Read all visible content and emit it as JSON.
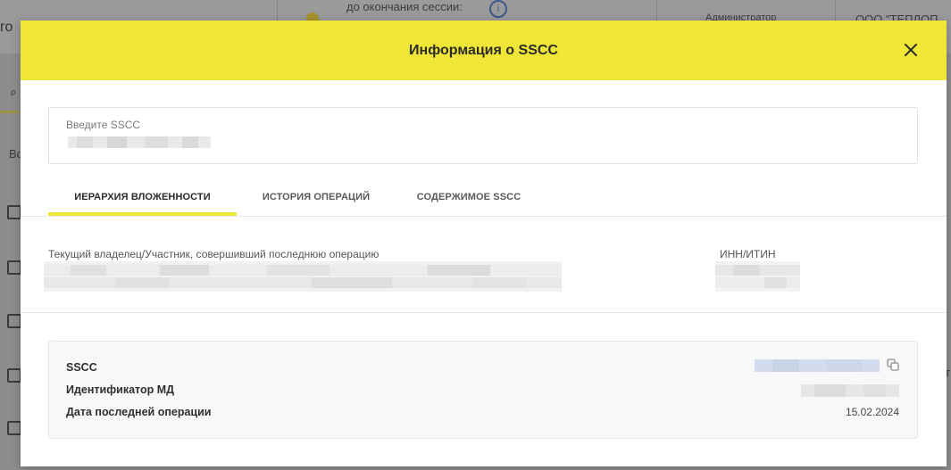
{
  "background": {
    "logo_fragment": "го",
    "session_text": "до окончания сессии:",
    "admin_text": "Администратор",
    "org_text": "ООО \"ТЕПЛОП",
    "tab_fragment": "Р",
    "left_fragment": "Во",
    "right_fragment": "т"
  },
  "modal": {
    "title": "Информация о SSCC",
    "close_icon": "close-icon",
    "sscc_input": {
      "label": "Введите SSCC"
    },
    "tabs": [
      {
        "label": "ИЕРАРХИЯ ВЛОЖЕННОСТИ",
        "active": true
      },
      {
        "label": "ИСТОРИЯ ОПЕРАЦИЙ",
        "active": false
      },
      {
        "label": "СОДЕРЖИМОЕ SSCC",
        "active": false
      }
    ],
    "owner": {
      "label": "Текущий владелец/Участник, совершивший последнюю операцию",
      "inn_label": "ИНН/ИТИН"
    },
    "details": {
      "sscc_label": "SSCC",
      "md_label": "Идентификатор МД",
      "last_op_label": "Дата последней операции",
      "last_op_value": "15.02.2024",
      "copy_icon": "copy-icon"
    }
  },
  "colors": {
    "accent_yellow": "#f0e637",
    "link_blue": "#c9d4e6"
  }
}
